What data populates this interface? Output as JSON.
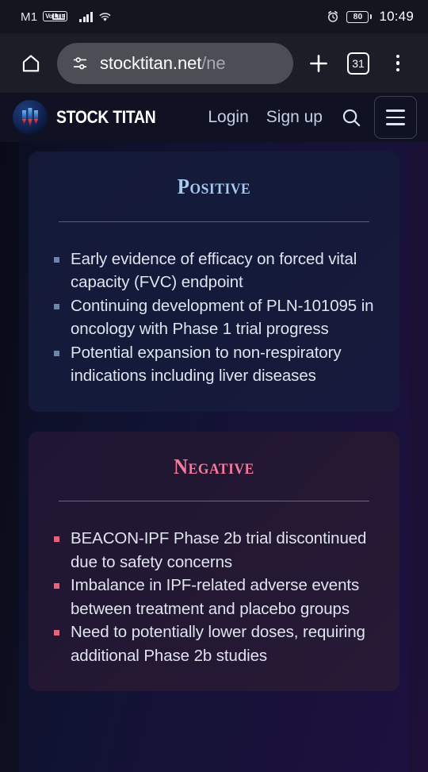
{
  "status_bar": {
    "carrier": "M1",
    "volte_prefix": "Vo",
    "volte_suffix": "LTE",
    "clock": "10:49",
    "battery_level": "80",
    "alarm_icon": "alarm-clock-icon",
    "wifi_icon": "wifi-icon",
    "signal_icon": "cellular-signal-icon"
  },
  "browser": {
    "home_icon": "home-icon",
    "site_settings_icon": "tune-icon",
    "url_host": "stocktitan.net",
    "url_path": "/ne",
    "new_tab_icon": "plus-icon",
    "tab_count": "31",
    "menu_icon": "three-dot-menu-icon"
  },
  "site_header": {
    "brand_name": "STOCK TITAN",
    "logo_icon": "stock-titan-logo",
    "login_label": "Login",
    "signup_label": "Sign up",
    "search_icon": "search-icon",
    "hamburger_icon": "hamburger-menu-icon"
  },
  "colors": {
    "positive_accent": "#a6cbf0",
    "negative_accent": "#f57a9e",
    "positive_bullet": "#6e84a8",
    "negative_bullet": "#e2647f",
    "page_background": "#0c0f22",
    "url_pill": "#4c4d55"
  },
  "cards": [
    {
      "title": "Positive",
      "bullets": [
        "Early evidence of efficacy on forced vital capacity (FVC) endpoint",
        "Continuing development of PLN-101095 in oncology with Phase 1 trial progress",
        "Potential expansion to non-respiratory indications including liver diseases"
      ]
    },
    {
      "title": "Negative",
      "bullets": [
        "BEACON-IPF Phase 2b trial discontinued due to safety concerns",
        "Imbalance in IPF-related adverse events between treatment and placebo groups",
        "Need to potentially lower doses, requiring additional Phase 2b studies"
      ]
    }
  ]
}
